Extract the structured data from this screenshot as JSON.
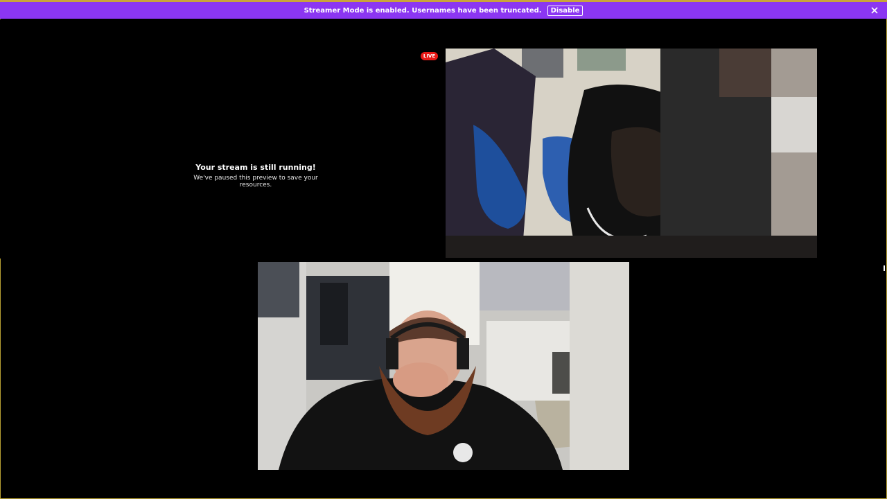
{
  "banner": {
    "message": "Streamer Mode is enabled. Usernames have been truncated.",
    "button_label": "Disable",
    "background": "#8b36f2",
    "close_icon": "close-icon"
  },
  "preview": {
    "title": "Your stream is still running!",
    "subtitle": "We've paused this preview to save your resources."
  },
  "live_badge": {
    "label": "LIVE",
    "color": "#e91916"
  },
  "videos": [
    {
      "name": "camera-feed-1"
    },
    {
      "name": "camera-feed-2"
    }
  ]
}
